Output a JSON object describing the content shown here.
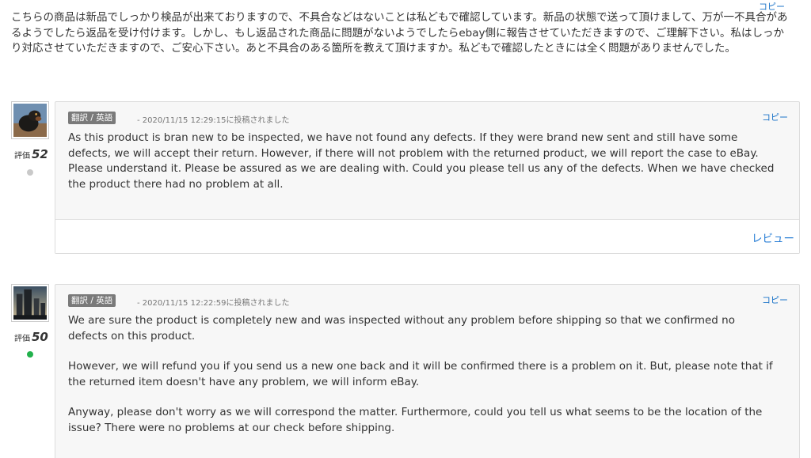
{
  "source": {
    "copy_label": "コピー",
    "text": "こちらの商品は新品でしっかり検品が出来ておりますので、不具合などはないことは私どもで確認しています。新品の状態で送って頂けまして、万が一不具合があるようでしたら返品を受け付けます。しかし、もし返品された商品に問題がないようでしたらebay側に報告させていただきますので、ご理解下さい。私はしっかり対応させていただきますので、ご安心下さい。あと不具合のある箇所を教えて頂けますか。私どもで確認したときには全く問題がありませんでした。"
  },
  "translations": [
    {
      "rating_label": "評価",
      "rating_value": "52",
      "status_color": "#c9c9c9",
      "badge": "翻訳 / 英語",
      "posted": "- 2020/11/15 12:29:15に投稿されました",
      "copy_label": "コピー",
      "paragraphs": [
        "As this product is bran new to be inspected, we have not found any defects. If they were brand new sent and still have some defects, we will accept their return. However, if there will not problem with the returned product, we will report the case to eBay. Please understand it. Please be assured as we are dealing with. Could you please tell us any of the defects. When we have checked the product there had no problem at all."
      ],
      "review_label": "レビュー"
    },
    {
      "rating_label": "評価",
      "rating_value": "50",
      "status_color": "#22b14c",
      "badge": "翻訳 / 英語",
      "posted": "- 2020/11/15 12:22:59に投稿されました",
      "copy_label": "コピー",
      "paragraphs": [
        "We are sure the product is completely new and was inspected without any problem before shipping so that we confirmed no defects on this product.",
        "However, we will refund you if you send us a new one back and it will be confirmed there is a problem on it. But, please note that if the returned item doesn't have any problem, we will inform eBay.",
        "Anyway, please don't worry as we will correspond the matter. Furthermore, could you tell us what seems to be the location of the issue? There were no problems at our check before shipping."
      ]
    }
  ]
}
